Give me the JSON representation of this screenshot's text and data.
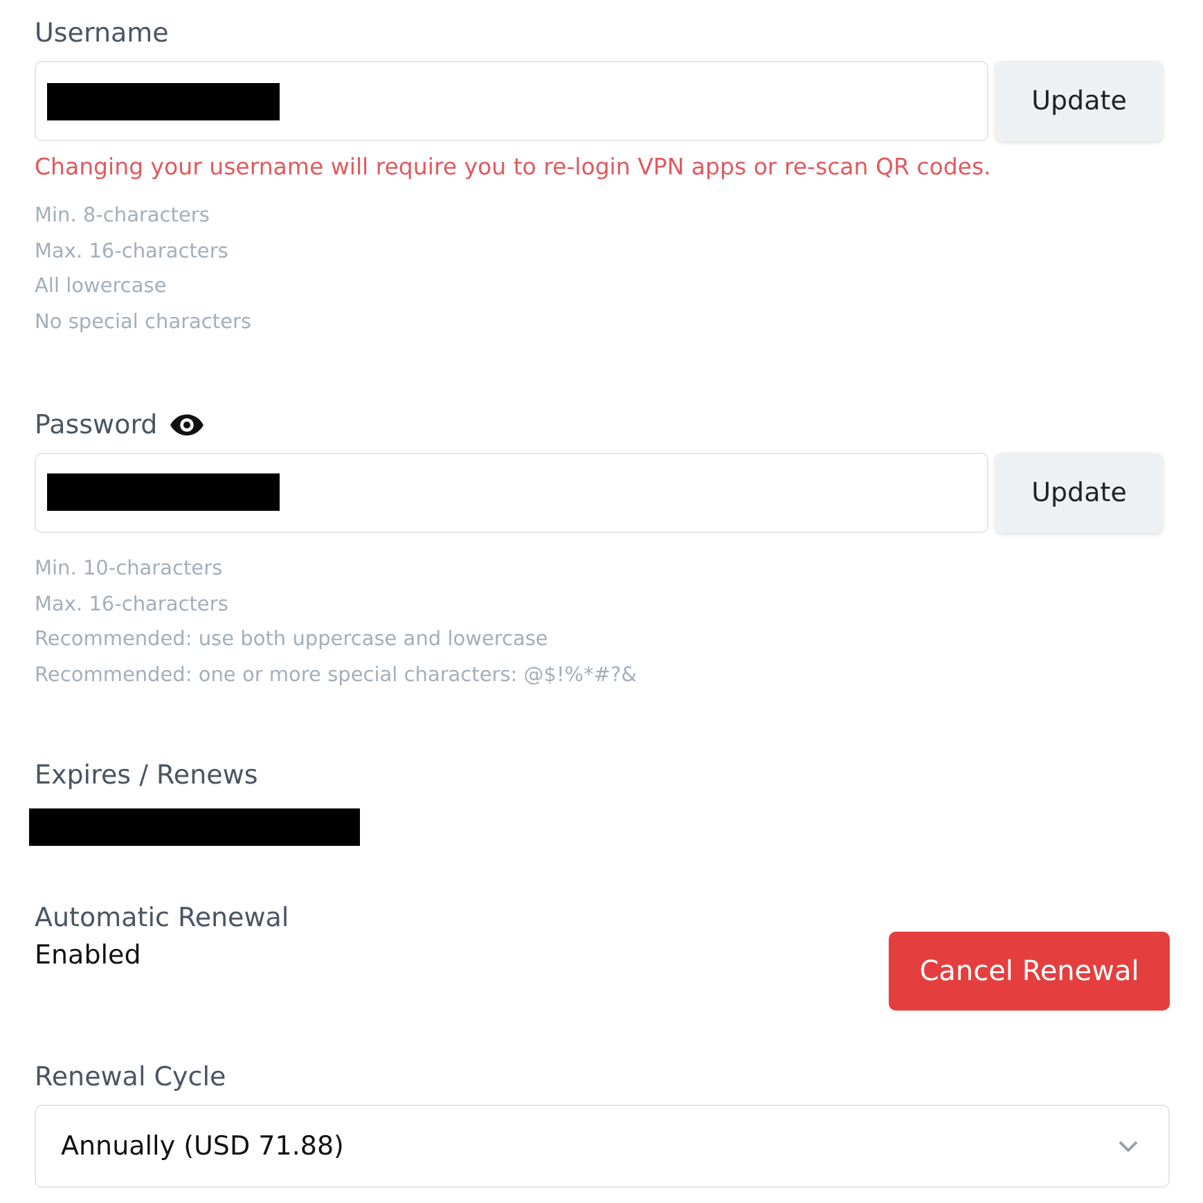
{
  "sections": [
    {
      "kind": "credential",
      "label": "Username",
      "show_toggle": false,
      "value_redacted": true,
      "button": "Update",
      "warning": "Changing your username will require you to re-login VPN apps or re-scan QR codes.",
      "hints": [
        "Min. 8-characters",
        "Max. 16-characters",
        "All lowercase",
        "No special characters"
      ]
    },
    {
      "kind": "credential",
      "label": "Password",
      "show_toggle": true,
      "value_redacted": true,
      "button": "Update",
      "hints": [
        "Min. 10-characters",
        "Max. 16-characters",
        "Recommended: use both uppercase and lowercase",
        "Recommended: one or more special characters: @$!%*#?&"
      ]
    },
    {
      "kind": "info",
      "label": "Expires / Renews",
      "value_redacted": true
    },
    {
      "kind": "status",
      "label": "Automatic Renewal",
      "value": "Enabled",
      "button": "Cancel Renewal"
    },
    {
      "kind": "select",
      "label": "Renewal Cycle",
      "value": "Annually (USD 71.88)"
    }
  ]
}
